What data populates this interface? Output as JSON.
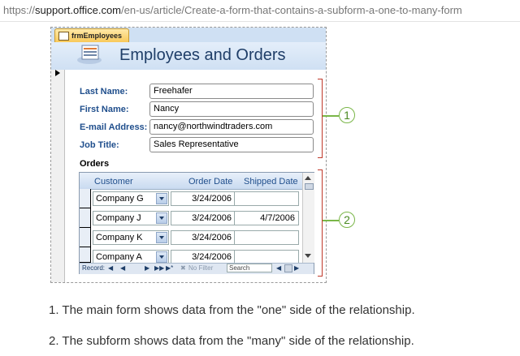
{
  "browser": {
    "url_protocol": "https://",
    "url_host": "support.office.com",
    "url_path": "/en-us/article/Create-a-form-that-contains-a-subform-a-one-to-many-form"
  },
  "form": {
    "tab_label": "frmEmployees",
    "title": "Employees and Orders",
    "fields": [
      {
        "label": "Last Name:",
        "value": "Freehafer"
      },
      {
        "label": "First Name:",
        "value": "Nancy"
      },
      {
        "label": "E-mail Address:",
        "value": "nancy@northwindtraders.com"
      },
      {
        "label": "Job Title:",
        "value": "Sales Representative"
      }
    ]
  },
  "subform": {
    "label": "Orders",
    "columns": [
      "Customer",
      "Order Date",
      "Shipped Date"
    ],
    "rows": [
      {
        "customer": "Company G",
        "order_date": "3/24/2006",
        "shipped_date": ""
      },
      {
        "customer": "Company J",
        "order_date": "3/24/2006",
        "shipped_date": "4/7/2006"
      },
      {
        "customer": "Company K",
        "order_date": "3/24/2006",
        "shipped_date": ""
      },
      {
        "customer": "Company A",
        "order_date": "3/24/2006",
        "shipped_date": ""
      }
    ],
    "nav": {
      "record_label": "Record:",
      "first": "◀",
      "prev": "◀",
      "next": "▶",
      "last": "▶▶",
      "new": "▶*",
      "filter": "No Filter",
      "search": "Search"
    }
  },
  "callouts": [
    "1",
    "2"
  ],
  "notes": [
    "1. The main form shows data from the \"one\" side of the relationship.",
    "2. The subform shows data from the \"many\" side of the relationship."
  ],
  "colors": {
    "bracket": "#c0392b",
    "callout": "#7ab648",
    "label": "#1f4e8c",
    "title": "#1f3e68"
  }
}
